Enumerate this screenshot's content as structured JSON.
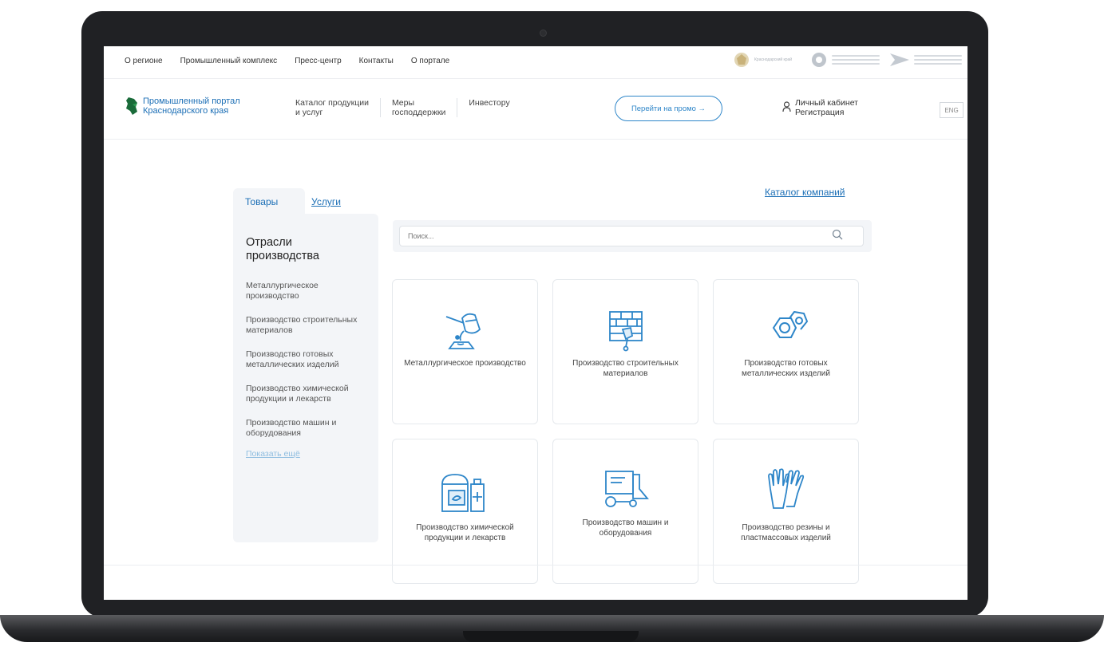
{
  "topnav": {
    "items": [
      "О регионе",
      "Промышленный комплекс",
      "Пресс-центр",
      "Контакты",
      "О портале"
    ]
  },
  "partners": {
    "krasnodar_label": "Краснодарский край"
  },
  "logo": {
    "line1": "Промышленный портал",
    "line2": "Краснодарского края"
  },
  "mainnav": {
    "items": [
      "Каталог продукции\nи услуг",
      "Меры\nгосподдержки",
      "Инвестору"
    ]
  },
  "promo": {
    "label": "Перейти на промо →"
  },
  "account": {
    "cabinet": "Личный кабинет",
    "register": "Регистрация"
  },
  "lang": {
    "label": "ENG"
  },
  "tabs": {
    "goods": "Товары",
    "services": "Услуги"
  },
  "sidebar": {
    "title": "Отрасли производства",
    "items": [
      "Металлургическое производство",
      "Производство строительных материалов",
      "Производство готовых металлических изделий",
      "Производство химической продукции и лекарств",
      "Производство машин и оборудования"
    ],
    "show_more": "Показать ещё"
  },
  "companies_link": "Каталог компаний",
  "search": {
    "placeholder": "Поиск..."
  },
  "cards": [
    {
      "label": "Металлургическое производство",
      "icon": "ladle-icon"
    },
    {
      "label": "Производство строительных материалов",
      "icon": "brick-wall-icon"
    },
    {
      "label": "Производство готовых металлических изделий",
      "icon": "hex-nut-icon"
    },
    {
      "label": "Производство химической продукции и лекарств",
      "icon": "chemicals-icon"
    },
    {
      "label": "Производство машин и оборудования",
      "icon": "harvester-icon"
    },
    {
      "label": "Производство резины и пластмассовых изделий",
      "icon": "gloves-icon"
    }
  ],
  "colors": {
    "accent": "#2e86c9",
    "link": "#1c6fb6",
    "panel": "#f3f5f8",
    "frame": "#202124"
  }
}
